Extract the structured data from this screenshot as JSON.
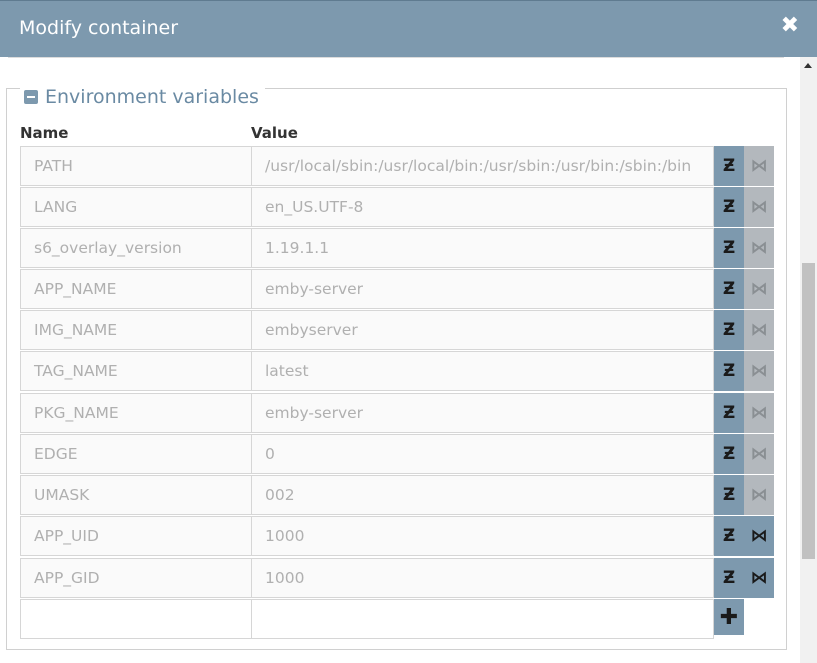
{
  "dialog": {
    "title": "Modify container",
    "close_glyph": "✖"
  },
  "section": {
    "legend": "Environment variables",
    "toggle_icon": "minus-square-icon"
  },
  "columns": {
    "name": "Name",
    "value": "Value"
  },
  "env_vars": [
    {
      "name": "PATH",
      "value": "/usr/local/sbin:/usr/local/bin:/usr/sbin:/usr/bin:/sbin:/bin",
      "delete_enabled": false
    },
    {
      "name": "LANG",
      "value": "en_US.UTF-8",
      "delete_enabled": false
    },
    {
      "name": "s6_overlay_version",
      "value": "1.19.1.1",
      "delete_enabled": false
    },
    {
      "name": "APP_NAME",
      "value": "emby-server",
      "delete_enabled": false
    },
    {
      "name": "IMG_NAME",
      "value": "embyserver",
      "delete_enabled": false
    },
    {
      "name": "TAG_NAME",
      "value": "latest",
      "delete_enabled": false
    },
    {
      "name": "PKG_NAME",
      "value": "emby-server",
      "delete_enabled": false
    },
    {
      "name": "EDGE",
      "value": "0",
      "delete_enabled": false
    },
    {
      "name": "UMASK",
      "value": "002",
      "delete_enabled": false
    },
    {
      "name": "APP_UID",
      "value": "1000",
      "delete_enabled": true
    },
    {
      "name": "APP_GID",
      "value": "1000",
      "delete_enabled": true
    }
  ],
  "new_row": {
    "name": "",
    "value": "",
    "add_glyph": "✚"
  },
  "icons": {
    "edit": "Ƶ",
    "delete": "⋈"
  },
  "colors": {
    "accent": "#7d99ae",
    "disabled": "#b3b8bd"
  }
}
